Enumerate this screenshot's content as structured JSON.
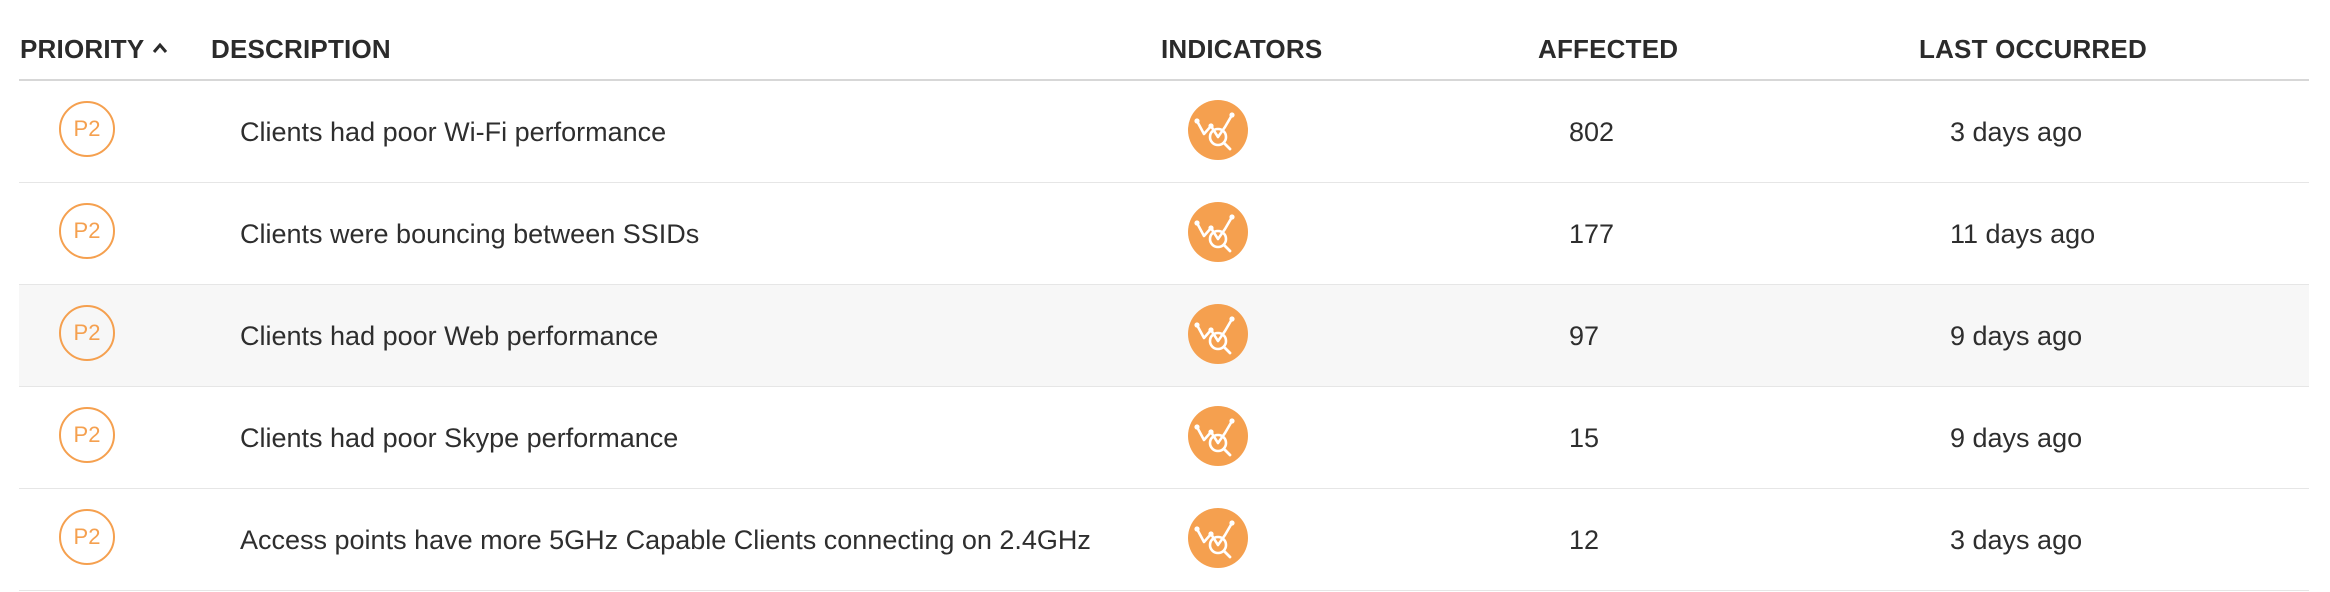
{
  "table": {
    "headers": {
      "priority": "PRIORITY",
      "description": "DESCRIPTION",
      "indicators": "INDICATORS",
      "affected": "AFFECTED",
      "last_occurred": "LAST OCCURRED"
    },
    "sort": {
      "column": "priority",
      "direction": "ascending",
      "icon": "chevron-up-icon"
    },
    "rows": [
      {
        "priority": "P2",
        "description": "Clients had poor Wi-Fi performance",
        "indicator_icon": "performance-analytics-icon",
        "affected": "802",
        "last_occurred": "3 days ago"
      },
      {
        "priority": "P2",
        "description": "Clients were bouncing between SSIDs",
        "indicator_icon": "performance-analytics-icon",
        "affected": "177",
        "last_occurred": "11 days ago"
      },
      {
        "priority": "P2",
        "description": "Clients had poor Web performance",
        "indicator_icon": "performance-analytics-icon",
        "affected": "97",
        "last_occurred": "9 days ago"
      },
      {
        "priority": "P2",
        "description": "Clients had poor Skype performance",
        "indicator_icon": "performance-analytics-icon",
        "affected": "15",
        "last_occurred": "9 days ago"
      },
      {
        "priority": "P2",
        "description": "Access points have more 5GHz Capable Clients connecting on 2.4GHz",
        "indicator_icon": "performance-analytics-icon",
        "affected": "12",
        "last_occurred": "3 days ago"
      }
    ]
  },
  "colors": {
    "priority_accent": "#f5a04f",
    "indicator_fill": "#f5a04f",
    "header_rule": "#d7d7d7",
    "highlight_row": "#f7f7f7"
  }
}
